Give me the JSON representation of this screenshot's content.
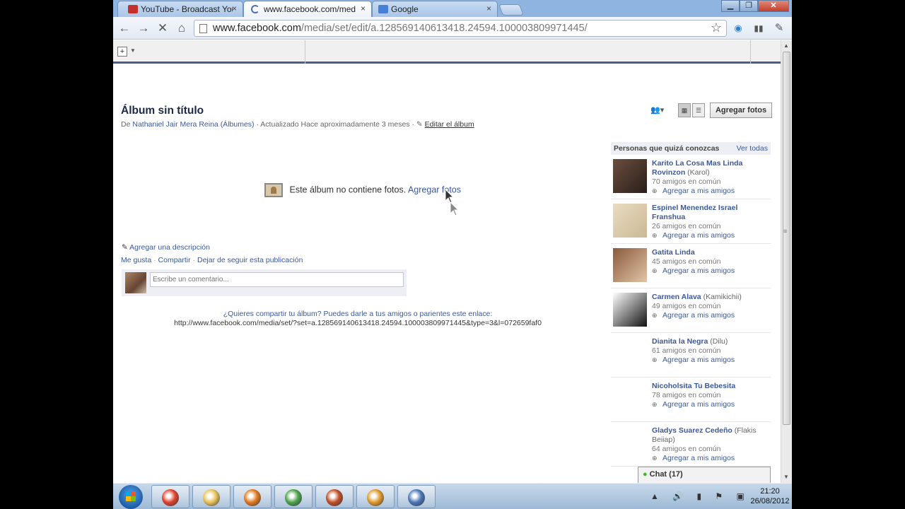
{
  "browser": {
    "tabs": [
      {
        "title": "YouTube - Broadcast Yourself",
        "favicon_color": "#c4302b",
        "active": false
      },
      {
        "title": "www.facebook.com/media/set/edit",
        "favicon_color": "#ffffff",
        "active": true
      },
      {
        "title": "Google",
        "favicon_color": "#4a7fd6",
        "active": false
      }
    ],
    "tab_close": "×",
    "url_host": "www.facebook.com",
    "url_path": "/media/set/edit/a.128569140613418.24594.100003809971445/",
    "window_buttons": {
      "minimize": "▁",
      "maximize": "❐",
      "close": "✕"
    },
    "nav": {
      "back": "←",
      "forward": "→",
      "stop": "✕",
      "home": "⌂",
      "bookmark_star": "☆"
    }
  },
  "album": {
    "title": "Álbum sin título",
    "meta_prefix": "De",
    "owner": "Nathaniel Jair Mera Reina",
    "albums_link": "(Álbumes)",
    "updated": "· Actualizado Hace aproximadamente 3 meses ·",
    "edit_link": "Editar el álbum",
    "add_photos_button": "Agregar fotos",
    "empty_text": "Este álbum no contiene fotos.",
    "empty_add_link": "Agregar fotos",
    "add_description": "Agregar una descripción",
    "actions": [
      "Me gusta",
      "Compartir",
      "Dejar de seguir esta publicación"
    ],
    "comment_placeholder": "Escribe un comentario...",
    "share_question": "¿Quieres compartir tu álbum? Puedes darle a tus amigos o parientes este enlace:",
    "share_link": "http://www.facebook.com/media/set/?set=a.128569140613418.24594.100003809971445&type=3&l=072659faf0"
  },
  "pymk": {
    "title": "Personas que quizá conozcas",
    "see_all": "Ver todas",
    "add_label": "Agregar a mis amigos",
    "people": [
      {
        "name": "Karito La Cosa Mas Linda Rovinzon",
        "nick": "(Karol)",
        "mutual": "70 amigos en común",
        "pic_colors": [
          "#6b4e3d",
          "#2a1e1a"
        ]
      },
      {
        "name": "Espinel Menendez Israel Franshua",
        "nick": "",
        "mutual": "26 amigos en común",
        "pic_colors": [
          "#e8dcc0",
          "#cbb896"
        ]
      },
      {
        "name": "Gatita Linda",
        "nick": "",
        "mutual": "45 amigos en común",
        "pic_colors": [
          "#8a5a3c",
          "#e2c4a8"
        ]
      },
      {
        "name": "Carmen Alava",
        "nick": "(Kamikichii)",
        "mutual": "49 amigos en común",
        "pic_colors": [
          "#ffffff",
          "#111111"
        ]
      },
      {
        "name": "Dianita la Negra",
        "nick": "(Dilu)",
        "mutual": "61 amigos en común",
        "pic_colors": [
          "#ffffff",
          "#ffffff"
        ]
      },
      {
        "name": "Nicoholsita Tu Bebesita",
        "nick": "",
        "mutual": "78 amigos en común",
        "pic_colors": [
          "#ffffff",
          "#ffffff"
        ]
      },
      {
        "name": "Gladys Suarez Cedeño",
        "nick": "(Flakis Beiiap)",
        "mutual": "64 amigos en común",
        "pic_colors": [
          "#ffffff",
          "#ffffff"
        ]
      }
    ]
  },
  "chat": {
    "label": "Chat (17)"
  },
  "taskbar": {
    "apps": [
      {
        "name": "chrome",
        "color": "#e0432f"
      },
      {
        "name": "explorer",
        "color": "#e6c25a"
      },
      {
        "name": "firefox",
        "color": "#e07a1f"
      },
      {
        "name": "messenger",
        "color": "#4da34d"
      },
      {
        "name": "ball-app",
        "color": "#c0502a"
      },
      {
        "name": "media-player",
        "color": "#e09a30"
      },
      {
        "name": "control-panel",
        "color": "#4a78b8"
      }
    ],
    "tray_icons": "▲ 🔊 ▮ ⚑ ▣",
    "time": "21:20",
    "date": "26/08/2012"
  }
}
